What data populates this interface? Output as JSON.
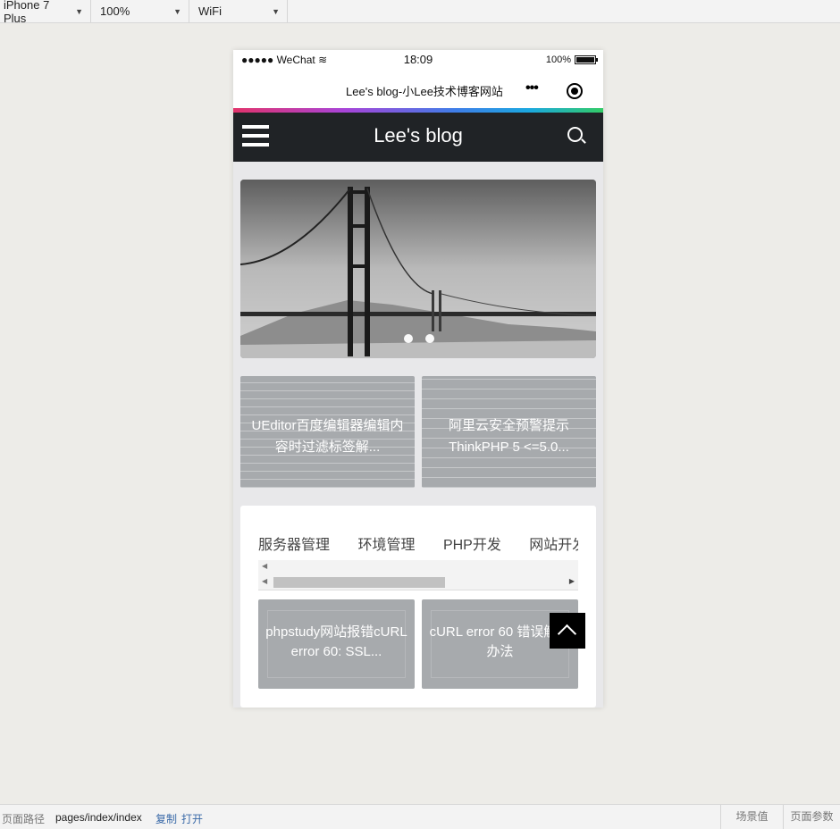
{
  "toolbar": {
    "device": "iPhone 7 Plus",
    "zoom": "100%",
    "network": "WiFi"
  },
  "status_bar": {
    "carrier": "●●●●● WeChat",
    "time": "18:09",
    "battery": "100%"
  },
  "nav": {
    "title": "Lee's blog-小Lee技术博客网站",
    "more": "•••"
  },
  "header": {
    "brand": "Lee's blog"
  },
  "banner": {
    "dots": 2
  },
  "featured": [
    {
      "title": "UEditor百度编辑器编辑内容时过滤标签解..."
    },
    {
      "title": "阿里云安全预警提示ThinkPHP 5 <=5.0..."
    }
  ],
  "tabs": [
    "服务器管理",
    "环境管理",
    "PHP开发",
    "网站开发"
  ],
  "posts": [
    {
      "title": "phpstudy网站报错cURL error 60: SSL..."
    },
    {
      "title": "cURL error 60 错误解决办法"
    }
  ],
  "bottom_bar": {
    "path_label": "页面路径",
    "path": "pages/index/index",
    "copy": "复制",
    "open": "打开",
    "scene": "场景值",
    "params": "页面参数"
  },
  "colors": {
    "header_bg": "#202326",
    "link": "#3a6aa8"
  }
}
